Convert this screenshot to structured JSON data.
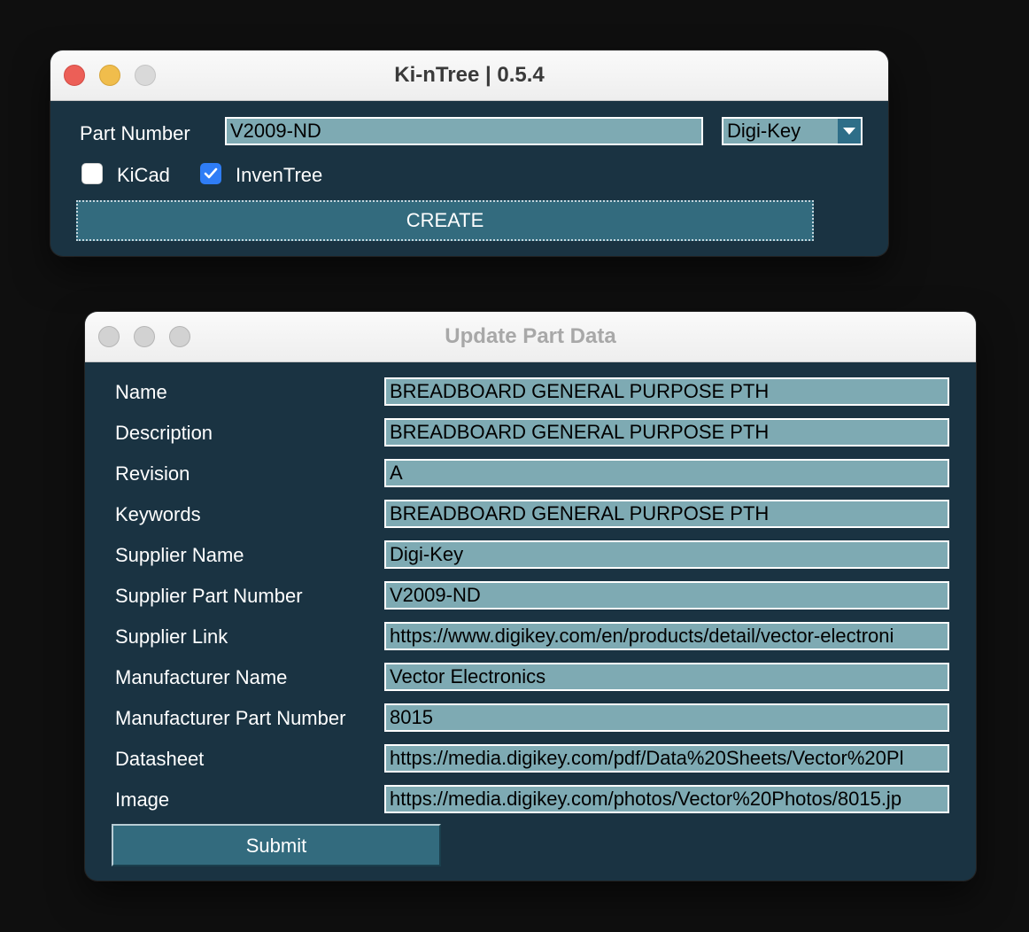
{
  "main_window": {
    "title": "Ki-nTree | 0.5.4",
    "part_number_label": "Part Number",
    "part_number_value": "V2009-ND",
    "supplier_select": "Digi-Key",
    "kicad_label": "KiCad",
    "kicad_checked": false,
    "inventree_label": "InvenTree",
    "inventree_checked": true,
    "create_label": "CREATE"
  },
  "update_window": {
    "title": "Update Part Data",
    "fields": [
      {
        "label": "Name",
        "value": "BREADBOARD GENERAL PURPOSE PTH"
      },
      {
        "label": "Description",
        "value": "BREADBOARD GENERAL PURPOSE PTH"
      },
      {
        "label": "Revision",
        "value": "A"
      },
      {
        "label": "Keywords",
        "value": "BREADBOARD GENERAL PURPOSE PTH"
      },
      {
        "label": "Supplier Name",
        "value": "Digi-Key"
      },
      {
        "label": "Supplier Part Number",
        "value": "V2009-ND"
      },
      {
        "label": "Supplier Link",
        "value": "https://www.digikey.com/en/products/detail/vector-electroni"
      },
      {
        "label": "Manufacturer Name",
        "value": "Vector Electronics"
      },
      {
        "label": "Manufacturer Part Number",
        "value": "8015"
      },
      {
        "label": "Datasheet",
        "value": "https://media.digikey.com/pdf/Data%20Sheets/Vector%20Pl"
      },
      {
        "label": "Image",
        "value": "https://media.digikey.com/photos/Vector%20Photos/8015.jp"
      }
    ],
    "submit_label": "Submit"
  },
  "colors": {
    "window_background": "#1a3342",
    "field_background": "#7eaab3",
    "button_background": "#336b7e",
    "checkbox_checked": "#2f7df6"
  }
}
